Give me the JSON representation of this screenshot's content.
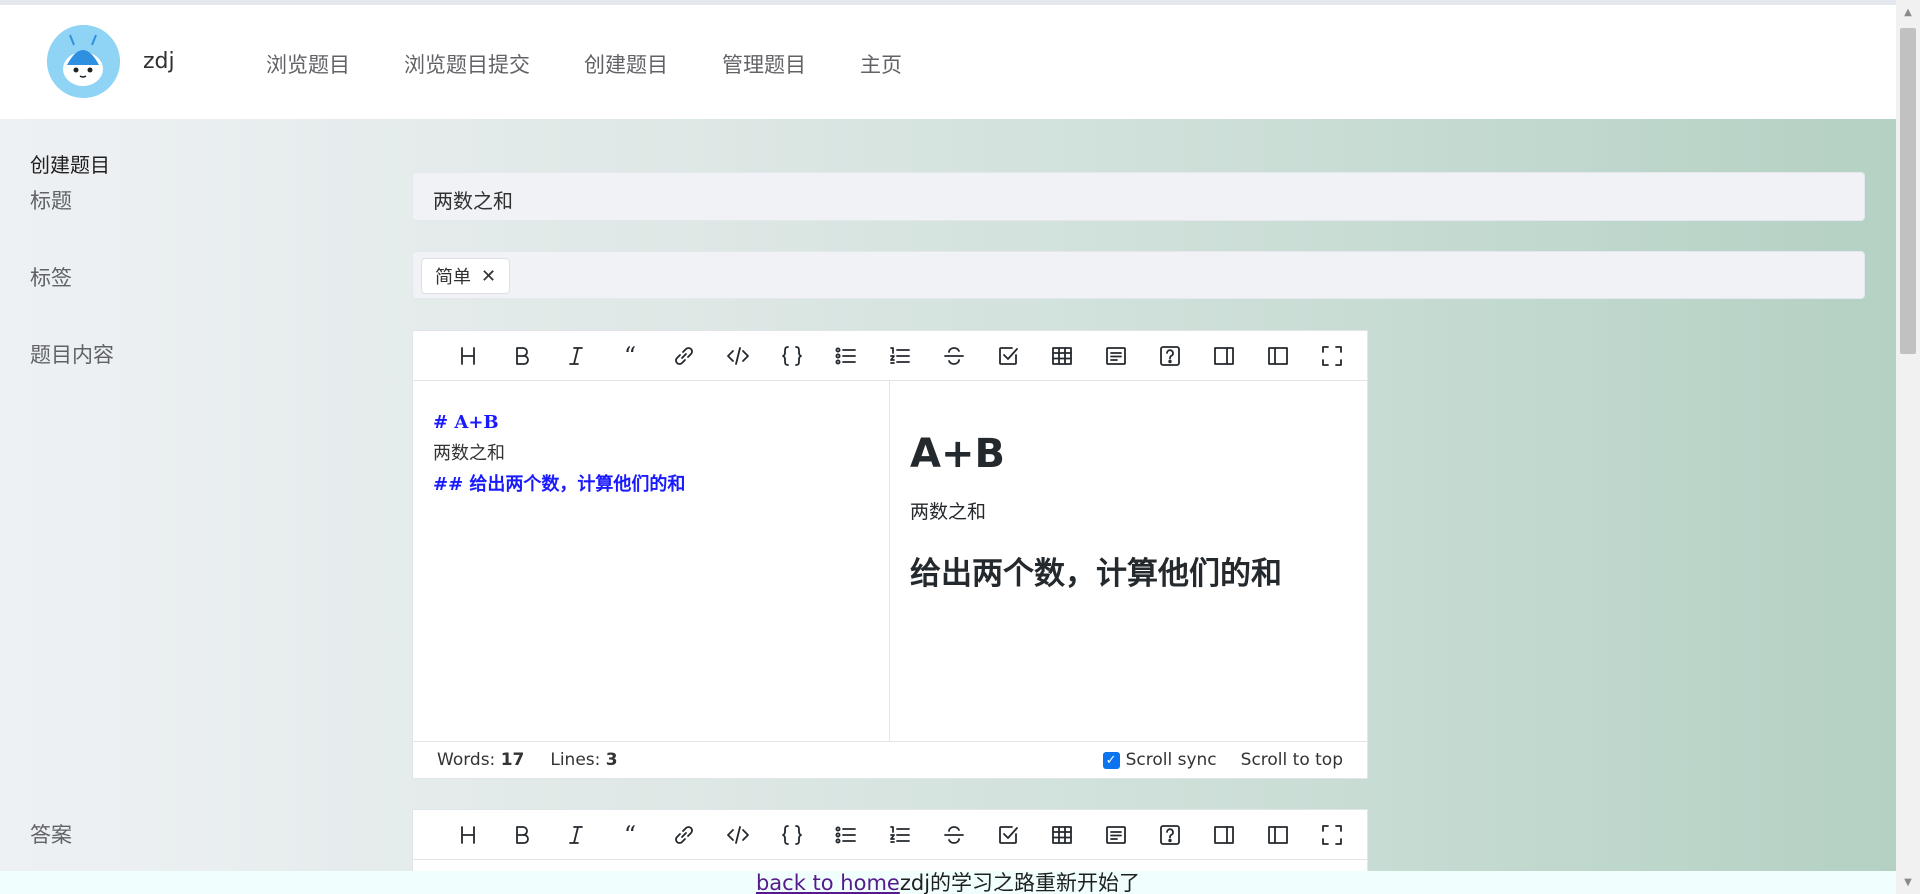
{
  "header": {
    "username": "zdj",
    "nav": [
      "浏览题目",
      "浏览题目提交",
      "创建题目",
      "管理题目",
      "主页"
    ]
  },
  "form": {
    "page_title": "创建题目",
    "title_label": "标题",
    "title_value": "两数之和",
    "tags_label": "标签",
    "tags": [
      "简单"
    ],
    "content_label": "题目内容",
    "answer_label": "答案"
  },
  "editor": {
    "source_lines": [
      {
        "kind": "heading",
        "text": "#  A+B"
      },
      {
        "kind": "text",
        "text": "两数之和"
      },
      {
        "kind": "heading",
        "text": "##  给出两个数，计算他们的和"
      }
    ],
    "preview": {
      "h1": "A+B",
      "p": "两数之和",
      "h2": "给出两个数，计算他们的和"
    },
    "status": {
      "words_label": "Words:",
      "words": "17",
      "lines_label": "Lines:",
      "lines": "3",
      "scroll_sync": "Scroll sync",
      "scroll_top": "Scroll to top"
    },
    "toolbar_icons": [
      "heading-icon",
      "bold-icon",
      "italic-icon",
      "quote-icon",
      "link-icon",
      "code-icon",
      "code-block-icon",
      "unordered-list-icon",
      "ordered-list-icon",
      "strikethrough-icon",
      "task-list-icon",
      "table-icon",
      "toc-icon",
      "help-icon",
      "preview-only-icon",
      "editor-only-icon",
      "fullscreen-icon"
    ]
  },
  "footer": {
    "link": "back to home",
    "text": "zdj的学习之路重新开始了"
  },
  "colors": {
    "heading_source": "#1a1aff",
    "checkbox": "#0b74ee",
    "footer_bg": "#f0fffd"
  }
}
